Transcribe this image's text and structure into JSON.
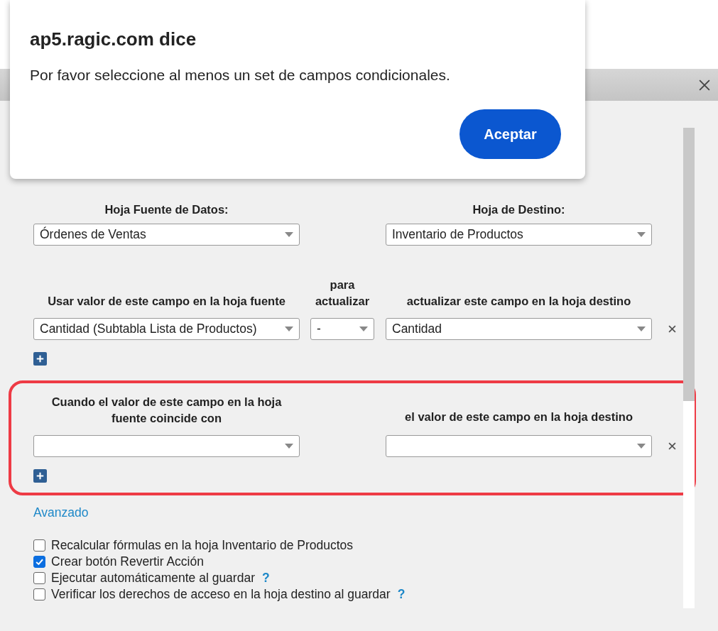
{
  "dialog": {
    "title": "ap5.ragic.com dice",
    "message": "Por favor seleccione al menos un set de campos condicionales.",
    "button": "Aceptar"
  },
  "sheets": {
    "source_label": "Hoja Fuente de Datos:",
    "source_value": "Órdenes de Ventas",
    "target_label": "Hoja de Destino:",
    "target_value": "Inventario de Productos"
  },
  "mapping": {
    "source_header": "Usar valor de este campo en la hoja fuente",
    "middle_header": "para actualizar",
    "target_header": "actualizar este campo en la hoja destino",
    "rows": [
      {
        "source": "Cantidad (Subtabla Lista de Productos)",
        "operation": "-",
        "target": "Cantidad"
      }
    ]
  },
  "conditions": {
    "highlighted": true,
    "source_header": "Cuando el valor de este campo en la hoja fuente coincide con",
    "target_header": "el valor de este campo en la hoja destino",
    "rows": [
      {
        "source": "",
        "target": ""
      }
    ]
  },
  "advanced_link": "Avanzado",
  "options": [
    {
      "label": "Recalcular fórmulas en la hoja Inventario de Productos",
      "checked": false,
      "help": false
    },
    {
      "label": "Crear botón Revertir Acción",
      "checked": true,
      "help": false
    },
    {
      "label": "Ejecutar automáticamente al guardar",
      "checked": false,
      "help": true
    },
    {
      "label": "Verificar los derechos de acceso en la hoja destino al guardar",
      "checked": false,
      "help": true
    }
  ],
  "help_mark": "?"
}
